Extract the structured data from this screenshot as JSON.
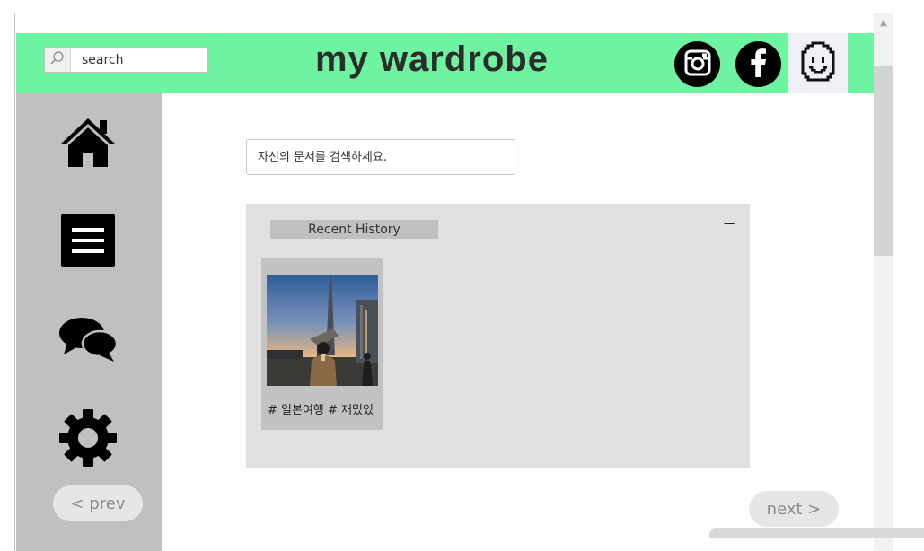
{
  "header": {
    "search_placeholder": "search",
    "title": "my wardrobe",
    "social": [
      "instagram-icon",
      "facebook-icon"
    ],
    "avatar_icon": "smiley-face-icon",
    "accent_color": "#6ef4a1"
  },
  "sidebar": {
    "items": [
      {
        "icon": "home-icon"
      },
      {
        "icon": "menu-icon"
      },
      {
        "icon": "chat-bubbles-icon"
      },
      {
        "icon": "gear-icon"
      }
    ],
    "prev_label": "< prev"
  },
  "main": {
    "doc_search_placeholder": "자신의 문서를 검색하세요.",
    "history": {
      "title": "Recent History",
      "collapse_label": "−",
      "items": [
        {
          "tags": "# 일본여행 # 재밌었"
        }
      ]
    },
    "next_label": "next >"
  }
}
